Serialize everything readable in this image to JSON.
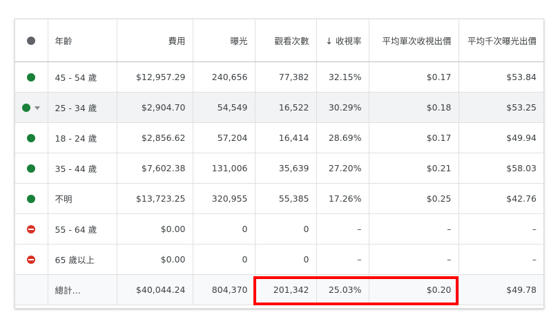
{
  "columns": {
    "status": "",
    "age": "年齡",
    "cost": "費用",
    "impressions": "曝光",
    "views": "觀看次數",
    "view_rate": "收視率",
    "avg_cpv": "平均單次收視出價",
    "avg_cpm": "平均千次曝光出價"
  },
  "sort_icon": "arrow-down-icon",
  "rows": [
    {
      "status": "enabled",
      "age": "45 - 54 歲",
      "cost": "$12,957.29",
      "impressions": "240,656",
      "views": "77,382",
      "view_rate": "32.15%",
      "avg_cpv": "$0.17",
      "avg_cpm": "$53.84"
    },
    {
      "status": "enabled",
      "age": "25 - 34 歲",
      "cost": "$2,904.70",
      "impressions": "54,549",
      "views": "16,522",
      "view_rate": "30.29%",
      "avg_cpv": "$0.18",
      "avg_cpm": "$53.25"
    },
    {
      "status": "enabled",
      "age": "18 - 24 歲",
      "cost": "$2,856.62",
      "impressions": "57,204",
      "views": "16,414",
      "view_rate": "28.69%",
      "avg_cpv": "$0.17",
      "avg_cpm": "$49.94"
    },
    {
      "status": "enabled",
      "age": "35 - 44 歲",
      "cost": "$7,602.38",
      "impressions": "131,006",
      "views": "35,639",
      "view_rate": "27.20%",
      "avg_cpv": "$0.21",
      "avg_cpm": "$58.03"
    },
    {
      "status": "enabled",
      "age": "不明",
      "cost": "$13,723.25",
      "impressions": "320,955",
      "views": "55,385",
      "view_rate": "17.26%",
      "avg_cpv": "$0.25",
      "avg_cpm": "$42.76"
    },
    {
      "status": "excluded",
      "age": "55 - 64 歲",
      "cost": "$0.00",
      "impressions": "0",
      "views": "0",
      "view_rate": "–",
      "avg_cpv": "–",
      "avg_cpm": "–"
    },
    {
      "status": "excluded",
      "age": "65 歲以上",
      "cost": "$0.00",
      "impressions": "0",
      "views": "0",
      "view_rate": "–",
      "avg_cpv": "–",
      "avg_cpm": "–"
    }
  ],
  "total": {
    "label": "總計…",
    "cost": "$40,044.24",
    "impressions": "804,370",
    "views": "201,342",
    "view_rate": "25.03%",
    "avg_cpv": "$0.20",
    "avg_cpm": "$49.78"
  },
  "colors": {
    "enabled": "#188038",
    "excluded": "#d93025",
    "highlight": "#ff0000"
  }
}
